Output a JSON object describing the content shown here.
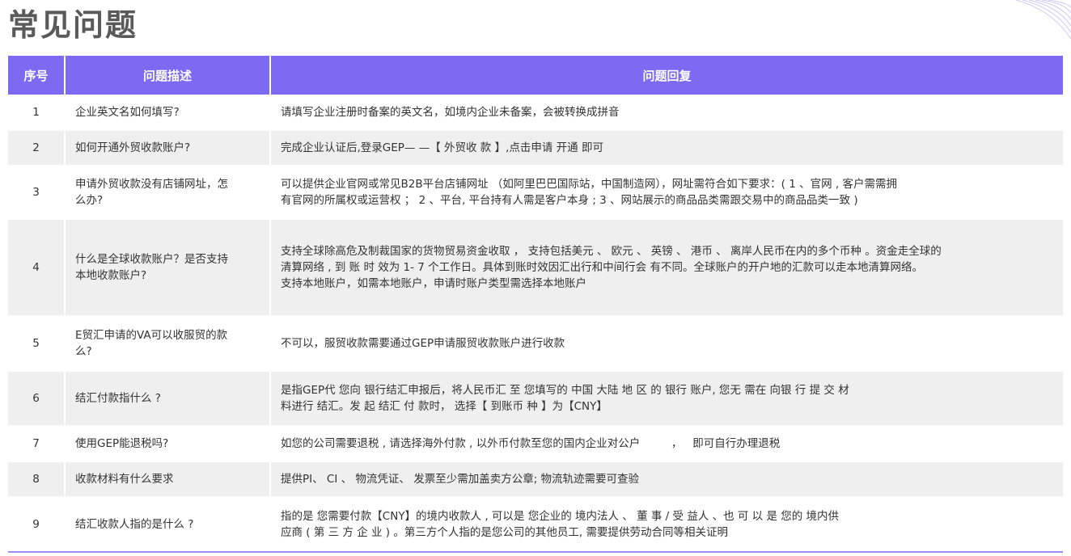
{
  "page": {
    "title": "常见问题"
  },
  "table": {
    "headers": [
      "序号",
      "问题描述",
      "问题回复"
    ],
    "rows": [
      {
        "num": "1",
        "question": [
          "企业英文名如何填写?"
        ],
        "answer": [
          "请填写企业注册时备案的英文名，如境内企业未备案，会被转换成拼音"
        ]
      },
      {
        "num": "2",
        "question": [
          "如何开通外贸收款账户?"
        ],
        "answer": [
          "完成企业认证后,登录GEP— —【 外贸收 款 】,点击申请 开通 即可"
        ]
      },
      {
        "num": "3",
        "question": [
          "申请外贸收款没有店铺网址，怎",
          "么办?"
        ],
        "answer": [
          "可以提供企业官网或常见B2B平台店铺网址 （如阿里巴巴国际站，中国制造网），网址需符合如下要求：( 1 、官网 , 客户需需拥",
          "有官网的所属权或运营权 ； 2 、平台, 平台持有人需是客户本身 ; 3 、网站展示的商品品类需跟交易中的商品品类一致 )"
        ]
      },
      {
        "num": "4",
        "question": [
          "什么是全球收款账户？是否支持",
          "本地收款账户?"
        ],
        "answer": [
          "支持全球除高危及制裁国家的货物贸易资金收取 ， 支持包括美元 、 欧元 、 英镑 、 港币 、 离岸人民币在内的多个币种 。资金走全球的",
          "清算网络 , 到 账 时 效为 1- 7 个工作日。具体到账时效因汇出行和中间行会 有不同。全球账户的开户地的汇款可以走本地清算网络。",
          "支持本地账户，如需本地账户，申请时账户类型需选择本地账户"
        ]
      },
      {
        "num": "5",
        "question": [
          "E贸汇申请的VA可以收服贸的款",
          "么?"
        ],
        "answer": [
          "不可以，服贸收款需要通过GEP申请服贸收款账户进行收款"
        ]
      },
      {
        "num": "6",
        "question": [
          "结汇付款指什么 ?"
        ],
        "answer": [
          "是指GEP代 您向 银行结汇申报后，将人民币汇 至 您填写的 中国 大陆 地 区 的 银行 账户, 您无 需在 向银 行 提 交 材",
          "料进行 结汇。发 起 结汇 付 款时， 选择【 到账币 种 】为【CNY】"
        ]
      },
      {
        "num": "7",
        "question": [
          "使用GEP能退税吗?"
        ],
        "answer": [
          "如您的公司需要退税 , 请选择海外付款 , 以外币付款至您的国内企业对公户         ，   即可自行办理退税"
        ]
      },
      {
        "num": "8",
        "question": [
          "收款材料有什么要求"
        ],
        "answer": [
          "提供PI、 CI 、 物流凭证、 发票至少需加盖卖方公章;  物流轨迹需要可查验"
        ]
      },
      {
        "num": "9",
        "question": [
          "结汇收款人指的是什么 ?"
        ],
        "answer": [
          "指的是 您需要付款【CNY】的境内收款人 , 可以是 您企业的 境内法人 、 董 事 / 受 益人 、也 可 以 是 您的 境内供",
          "应商 ( 第 三 方 企 业 ) 。第三方个人指的是您公司的其他员工, 需要提供劳动合同等相关证明"
        ]
      }
    ]
  },
  "colors": {
    "header_bg": "#7c6bf2",
    "stripe_bg": "#efefef",
    "title_color": "#5a5a5a"
  }
}
